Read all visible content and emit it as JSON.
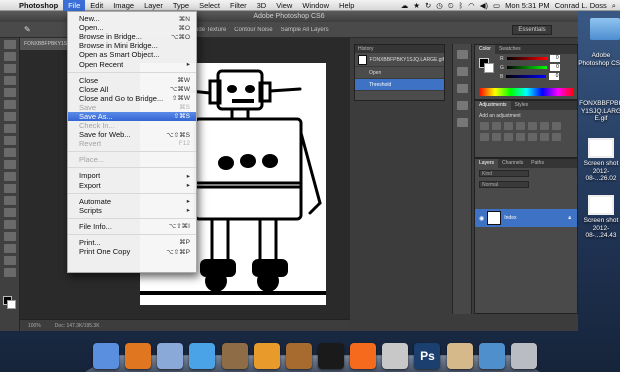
{
  "menubar": {
    "apple": "",
    "app": "Photoshop",
    "items": [
      "File",
      "Edit",
      "Image",
      "Layer",
      "Type",
      "Select",
      "Filter",
      "3D",
      "View",
      "Window",
      "Help"
    ],
    "status_icons": [
      "cloud-icon",
      "star-icon",
      "refresh-icon",
      "time-machine-icon",
      "clock-icon",
      "bluetooth-icon",
      "wifi-icon",
      "volume-icon",
      "battery-icon"
    ],
    "clock": "Mon 5:31 PM",
    "user": "Conrad L. Doss",
    "spotlight_icon": "magnifier-icon"
  },
  "photoshop": {
    "window_title": "Adobe Photoshop CS6",
    "options_bar": [
      "Crude Texture",
      "Contour Noise",
      "Sample All Layers"
    ],
    "workspace": "Essentials",
    "doc_tab": "FONXBBFPBKY1S...",
    "status_zoom": "100%",
    "status_doc": "Doc: 147.3K/195.3K",
    "history": {
      "title": "History",
      "snapshot": "FONXBBFPBKY1SJQ.LARGE.gif",
      "steps": [
        "Open",
        "Threshold"
      ],
      "selected_index": 1
    },
    "color_panel": {
      "tabs": [
        "Color",
        "Swatches"
      ],
      "channels": [
        {
          "label": "R",
          "value": "0"
        },
        {
          "label": "G",
          "value": "0"
        },
        {
          "label": "B",
          "value": "0"
        }
      ]
    },
    "adjustments": {
      "tabs": [
        "Adjustments",
        "Styles"
      ],
      "hint": "Add an adjustment"
    },
    "layers": {
      "tabs": [
        "Layers",
        "Channels",
        "Paths"
      ],
      "kind": "Kind",
      "blend": "Normal",
      "layer_name": "Index"
    }
  },
  "file_menu": {
    "items": [
      {
        "label": "New...",
        "shortcut": "⌘N",
        "state": "normal"
      },
      {
        "label": "Open...",
        "shortcut": "⌘O",
        "state": "normal"
      },
      {
        "label": "Browse in Bridge...",
        "shortcut": "⌥⌘O",
        "state": "normal"
      },
      {
        "label": "Browse in Mini Bridge...",
        "shortcut": "",
        "state": "normal"
      },
      {
        "label": "Open as Smart Object...",
        "shortcut": "",
        "state": "normal"
      },
      {
        "label": "Open Recent",
        "shortcut": "▸",
        "state": "normal",
        "sep_after": true
      },
      {
        "label": "Close",
        "shortcut": "⌘W",
        "state": "normal"
      },
      {
        "label": "Close All",
        "shortcut": "⌥⌘W",
        "state": "normal"
      },
      {
        "label": "Close and Go to Bridge...",
        "shortcut": "⇧⌘W",
        "state": "normal"
      },
      {
        "label": "Save",
        "shortcut": "⌘S",
        "state": "disabled"
      },
      {
        "label": "Save As...",
        "shortcut": "⇧⌘S",
        "state": "highlighted"
      },
      {
        "label": "Check In...",
        "shortcut": "",
        "state": "disabled"
      },
      {
        "label": "Save for Web...",
        "shortcut": "⌥⇧⌘S",
        "state": "normal"
      },
      {
        "label": "Revert",
        "shortcut": "F12",
        "state": "disabled",
        "sep_after": true
      },
      {
        "label": "Place...",
        "shortcut": "",
        "state": "disabled",
        "sep_after": true
      },
      {
        "label": "Import",
        "shortcut": "▸",
        "state": "normal"
      },
      {
        "label": "Export",
        "shortcut": "▸",
        "state": "normal",
        "sep_after": true
      },
      {
        "label": "Automate",
        "shortcut": "▸",
        "state": "normal"
      },
      {
        "label": "Scripts",
        "shortcut": "▸",
        "state": "normal",
        "sep_after": true
      },
      {
        "label": "File Info...",
        "shortcut": "⌥⇧⌘I",
        "state": "normal",
        "sep_after": true
      },
      {
        "label": "Print...",
        "shortcut": "⌘P",
        "state": "normal"
      },
      {
        "label": "Print One Copy",
        "shortcut": "⌥⇧⌘P",
        "state": "normal"
      }
    ]
  },
  "desktop": {
    "icons": [
      {
        "label": "",
        "kind": "folder-icon"
      },
      {
        "label": "Adobe Photoshop CS6",
        "kind": "photoshop-document-icon"
      },
      {
        "label": "FONXBBFPBKY1SJQ.LARGE.gif",
        "kind": "gif-file-icon"
      },
      {
        "label": "Screen shot 2012-08-...26.02",
        "kind": "screenshot-icon"
      },
      {
        "label": "Screen shot 2012-08-...24.43",
        "kind": "screenshot-icon"
      }
    ]
  },
  "dock": {
    "apps": [
      {
        "name": "finder-icon",
        "color": "#5a8fe0"
      },
      {
        "name": "firefox-icon",
        "color": "#e0761f"
      },
      {
        "name": "mail-stamp-icon",
        "color": "#8aa9d8"
      },
      {
        "name": "itunes-icon",
        "color": "#4aa3e6"
      },
      {
        "name": "iphoto-icon",
        "color": "#8e6c45"
      },
      {
        "name": "pages-icon",
        "color": "#e89b2a"
      },
      {
        "name": "garageband-guitar-icon",
        "color": "#a86b2f"
      },
      {
        "name": "ableton-live-icon",
        "color": "#1a1a1a"
      },
      {
        "name": "soundcloud-icon",
        "color": "#f56a1c"
      },
      {
        "name": "script-editor-icon",
        "color": "#c8c8c8"
      },
      {
        "name": "photoshop-icon",
        "color": "#1b3f6e"
      },
      {
        "name": "preview-icon",
        "color": "#d6b98a"
      },
      {
        "name": "downloads-stack-icon",
        "color": "#4e8fcc"
      },
      {
        "name": "trash-icon",
        "color": "#b9bcc2"
      }
    ]
  }
}
